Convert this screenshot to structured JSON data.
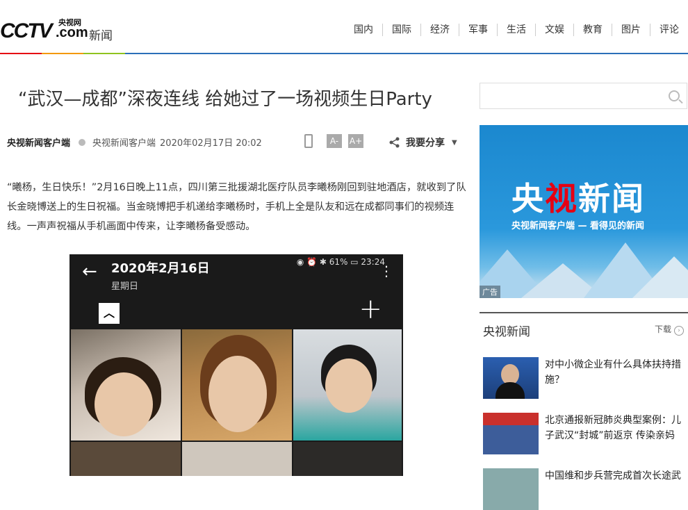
{
  "header": {
    "logo_cctv": "CCTV",
    "logo_small": "央视网",
    "logo_com": ".com",
    "logo_news": "新闻",
    "nav": [
      "国内",
      "国际",
      "经济",
      "军事",
      "生活",
      "文娱",
      "教育",
      "图片",
      "评论"
    ]
  },
  "article": {
    "title": "“武汉—成都”深夜连线 给她过了一场视频生日Party",
    "source": "央视新闻客户端",
    "source_detail": "央视新闻客户端",
    "datetime": "2020年02月17日 20:02",
    "font_minus": "A-",
    "font_plus": "A+",
    "share_label": "我要分享",
    "paragraph": "“曦杨，生日快乐！”2月16日晚上11点，四川第三批援湖北医疗队员李曦杨刚回到驻地酒店，就收到了队长金晓博送上的生日祝福。当金晓博把手机递给李曦杨时，手机上全是队友和远在成都同事们的视频连线。一声声祝福从手机画面中传来，让李曦杨备受感动。"
  },
  "photo": {
    "date": "2020年2月16日",
    "weekday": "星期日",
    "status": "◉ ⏰ ✱ 61% ▭ 23:24",
    "back": "←",
    "menu": "⋮",
    "up": "︿",
    "plus": "+"
  },
  "sidebar": {
    "search_placeholder": "",
    "ad_title_a": "央",
    "ad_title_b": "视",
    "ad_title_c": "新闻",
    "ad_sub": "央视新闻客户端 — 看得见的新闻",
    "ad_tag": "广告",
    "section_title": "央视新闻",
    "download": "下载",
    "news": [
      {
        "title": "对中小微企业有什么具体扶持措施？"
      },
      {
        "title": "北京通报新冠肺炎典型案例：儿子武汉“封城”前返京 传染亲妈"
      },
      {
        "title": "中国维和步兵营完成首次长途武"
      }
    ]
  }
}
